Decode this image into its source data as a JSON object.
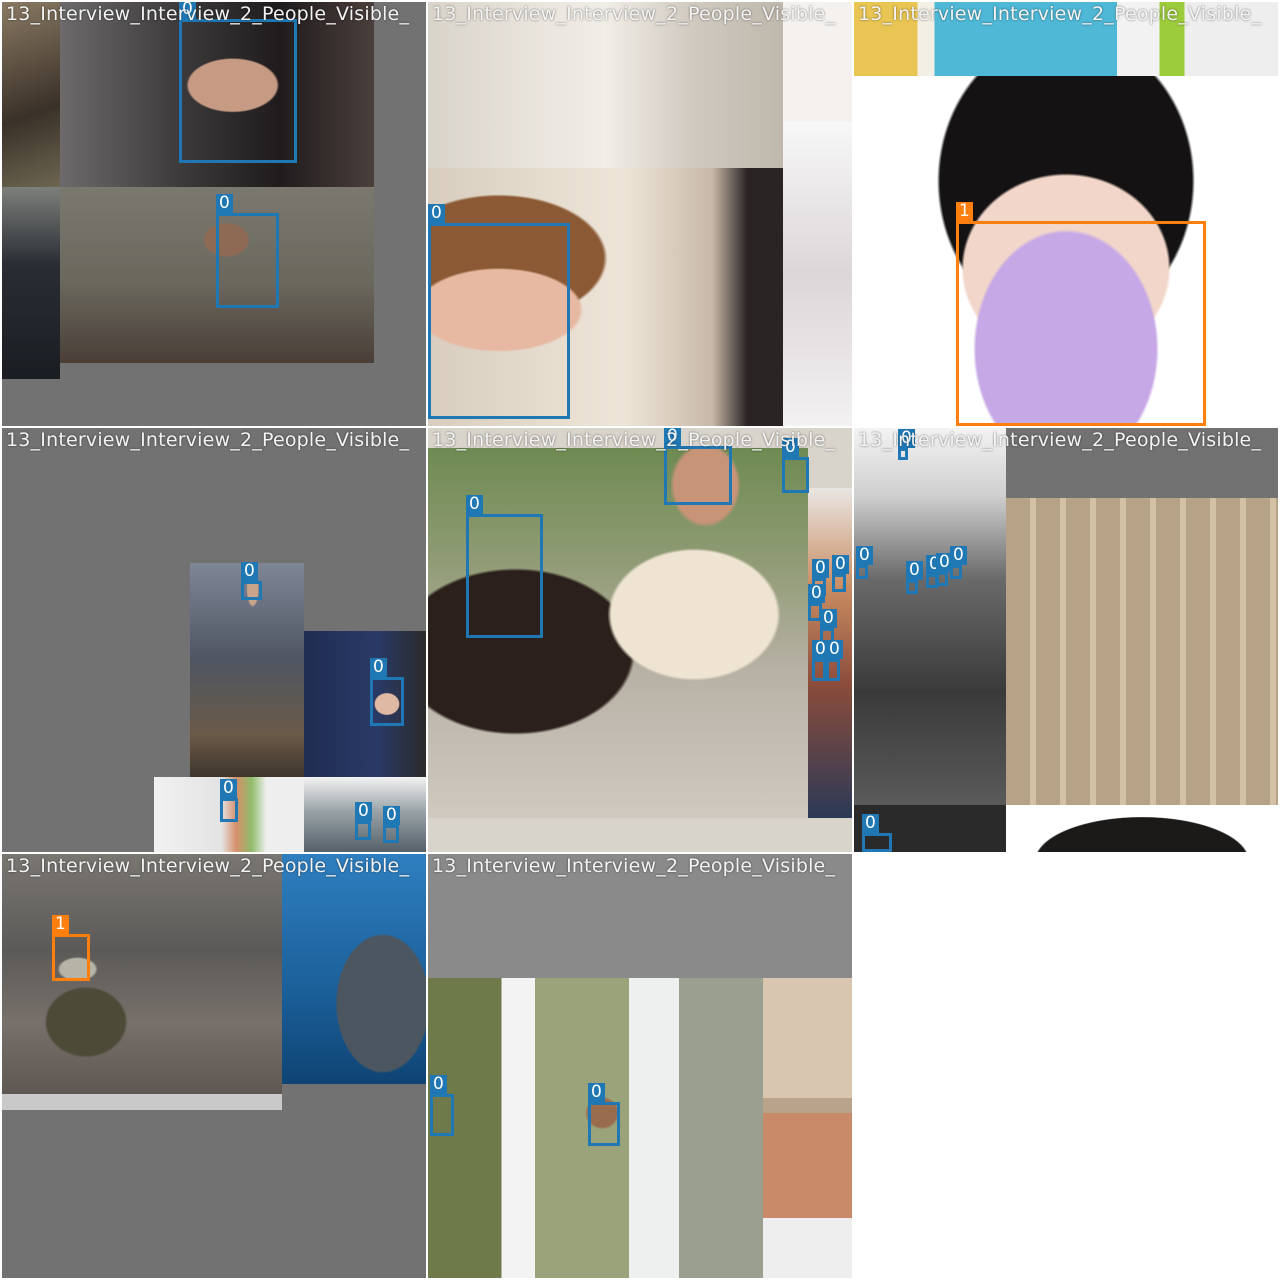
{
  "mosaic": {
    "tile_title": "13_Interview_Interview_2_People_Visible_",
    "class_colors": {
      "0": "#1f77b4",
      "1": "#ff7f0e"
    },
    "tiles": [
      {
        "title": "13_Interview_Interview_2_People_Visible_",
        "background": "#727272",
        "photos": [
          {
            "name": "photo-desk-items",
            "color": "#6f6151"
          },
          {
            "name": "photo-smiling-man-scarf",
            "color": "#2e2a2b"
          },
          {
            "name": "photo-man-sitting-striped-shirt",
            "color": "#6d6a5e"
          },
          {
            "name": "photo-police-officer",
            "color": "#4a4d52"
          }
        ],
        "boxes": [
          {
            "cls": "0"
          },
          {
            "cls": "0"
          }
        ]
      },
      {
        "title": "13_Interview_Interview_2_People_Visible_",
        "background": "#f4f1ee",
        "photos": [
          {
            "name": "photo-legs-white-pants",
            "color": "#cfcac2"
          },
          {
            "name": "photo-smiling-boy",
            "color": "#d9cdbf"
          },
          {
            "name": "photo-white-blur",
            "color": "#ece9ea"
          }
        ],
        "boxes": [
          {
            "cls": "0"
          }
        ]
      },
      {
        "title": "13_Interview_Interview_2_People_Visible_",
        "background": "#ffffff",
        "photos": [
          {
            "name": "photo-colorful-packages",
            "color": "#4fb8d6"
          },
          {
            "name": "photo-woman-purple-mask",
            "color": "#f3ece8"
          }
        ],
        "boxes": [
          {
            "cls": "1"
          }
        ]
      },
      {
        "title": "13_Interview_Interview_2_People_Visible_",
        "background": "#727272",
        "photos": [
          {
            "name": "photo-man-on-rocks",
            "color": "#5f6672"
          },
          {
            "name": "photo-woman-ralph-lauren-backdrop",
            "color": "#25304f"
          },
          {
            "name": "photo-performer-on-stage",
            "color": "#cf9a78"
          },
          {
            "name": "photo-people-under-tent",
            "color": "#8e9aa0"
          }
        ],
        "boxes": [
          {
            "cls": "0"
          },
          {
            "cls": "0"
          },
          {
            "cls": "0"
          },
          {
            "cls": "0"
          },
          {
            "cls": "0"
          }
        ]
      },
      {
        "title": "13_Interview_Interview_2_People_Visible_",
        "background": "#d8d3cb",
        "photos": [
          {
            "name": "photo-women-reading-paper",
            "color": "#9a8e7c"
          },
          {
            "name": "photo-crowd-strip",
            "color": "#b07a52"
          }
        ],
        "boxes": [
          {
            "cls": "0"
          },
          {
            "cls": "0"
          },
          {
            "cls": "0"
          },
          {
            "cls": "0"
          },
          {
            "cls": "0"
          },
          {
            "cls": "0"
          },
          {
            "cls": "0"
          },
          {
            "cls": "0"
          },
          {
            "cls": "0"
          }
        ]
      },
      {
        "title": "13_Interview_Interview_2_People_Visible_",
        "background": "#727272",
        "photos": [
          {
            "name": "photo-press-cameramen",
            "color": "#5c5c5c"
          },
          {
            "name": "photo-wooden-frame-construction",
            "color": "#b5a287"
          },
          {
            "name": "photo-hair-closeup",
            "color": "#1c1a19"
          },
          {
            "name": "photo-dark-strip",
            "color": "#2a2a2a"
          }
        ],
        "boxes": [
          {
            "cls": "0"
          },
          {
            "cls": "0"
          },
          {
            "cls": "0"
          },
          {
            "cls": "0"
          },
          {
            "cls": "0"
          },
          {
            "cls": "0"
          },
          {
            "cls": "0"
          }
        ]
      },
      {
        "title": "13_Interview_Interview_2_People_Visible_",
        "background": "#727272",
        "photos": [
          {
            "name": "photo-woman-masked-street",
            "color": "#6b6763"
          },
          {
            "name": "photo-whale-shark",
            "color": "#1f5f93"
          }
        ],
        "boxes": [
          {
            "cls": "1"
          }
        ]
      },
      {
        "title": "13_Interview_Interview_2_People_Visible_",
        "background": "#8a8a8a",
        "photos": [
          {
            "name": "photo-street-interview",
            "color": "#8d9279"
          },
          {
            "name": "photo-ornate-interior",
            "color": "#c6b49e"
          }
        ],
        "boxes": [
          {
            "cls": "0"
          },
          {
            "cls": "0"
          }
        ]
      }
    ]
  }
}
